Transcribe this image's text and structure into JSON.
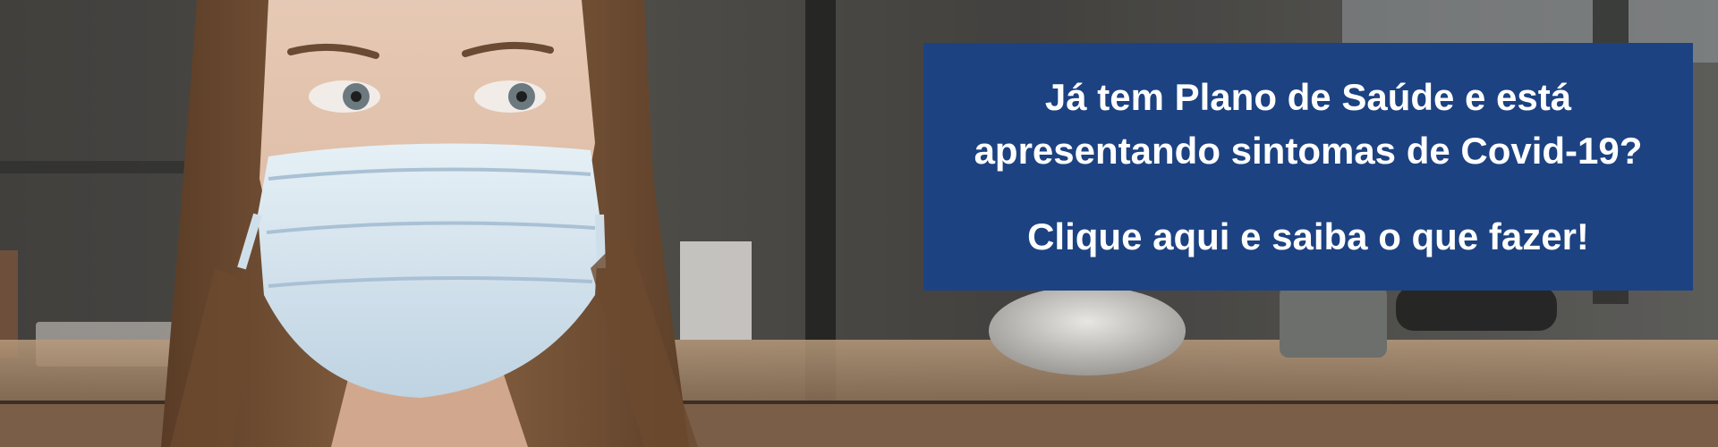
{
  "banner": {
    "headline_line1": "Já tem Plano de Saúde e está",
    "headline_line2": "apresentando sintomas de Covid-19?",
    "cta_text": "Clique aqui e saiba o que fazer!",
    "box_color": "#1c4282",
    "text_color": "#ffffff",
    "photo_subject": "woman-wearing-surgical-mask"
  }
}
